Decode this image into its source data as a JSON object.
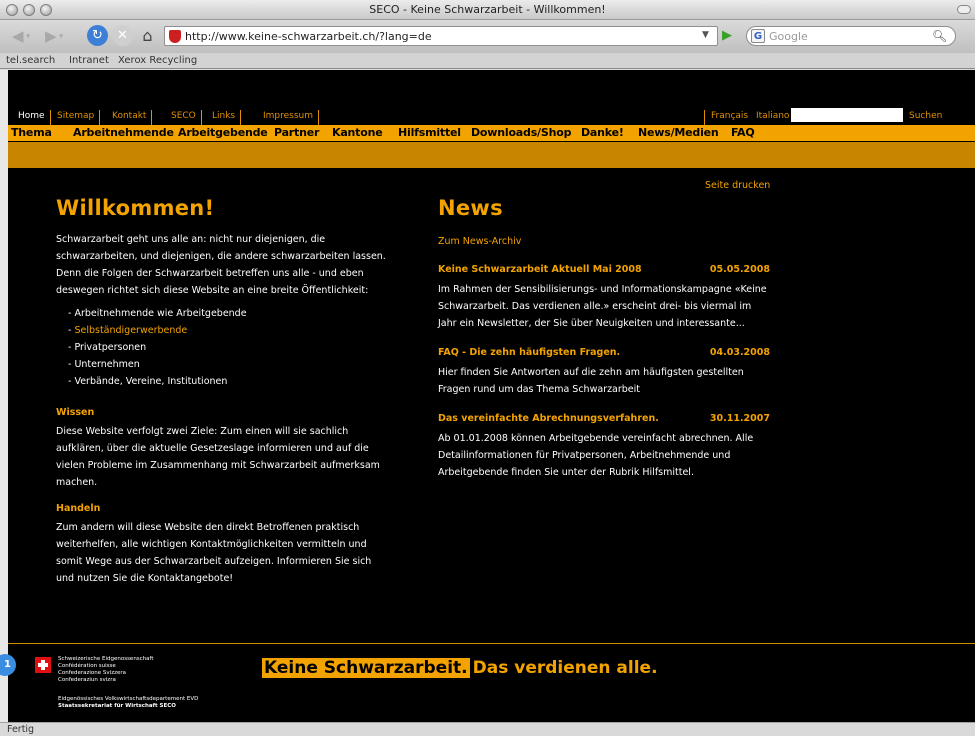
{
  "window": {
    "title": "SECO - Keine Schwarzarbeit - Willkommen!"
  },
  "toolbar": {
    "back_label": "◀",
    "forward_label": "▶",
    "url": "http://www.keine-schwarzarbeit.ch/?lang=de",
    "search_placeholder": "Google",
    "search_engine_letter": "G"
  },
  "bookmarks": [
    "tel.search",
    "Intranet",
    "Xerox Recycling"
  ],
  "site": {
    "topnav": [
      "Home",
      "Sitemap",
      "Kontakt",
      "SECO",
      "Links",
      "Impressum"
    ],
    "languages": [
      "Français",
      "Italiano"
    ],
    "search_button": "Suchen",
    "mainnav": [
      "Thema",
      "Arbeitnehmende",
      "Arbeitgebende",
      "Partner",
      "Kantone",
      "Hilfsmittel",
      "Downloads/Shop",
      "Danke!",
      "News/Medien",
      "FAQ"
    ],
    "print_link": "Seite drucken"
  },
  "welcome": {
    "title": "Willkommen!",
    "intro_lines": [
      "Schwarzarbeit geht uns alle an: nicht nur diejenigen, die",
      "schwarzarbeiten, und diejenigen, die andere schwarzarbeiten lassen.",
      "Denn die Folgen der Schwarzarbeit betreffen uns alle - und eben",
      "deswegen richtet sich diese Website an eine breite Öffentlichkeit:"
    ],
    "audiences": [
      "Arbeitnehmende wie Arbeitgebende",
      "Selbständigerwerbende",
      "Privatpersonen",
      "Unternehmen",
      "Verbände, Vereine, Institutionen"
    ],
    "wissen_title": "Wissen",
    "wissen_lines": [
      "Diese Website verfolgt zwei Ziele: Zum einen will sie sachlich",
      "aufklären, über die aktuelle Gesetzeslage informieren und auf die",
      "vielen Probleme im Zusammenhang mit Schwarzarbeit aufmerksam",
      "machen."
    ],
    "handeln_title": "Handeln",
    "handeln_lines": [
      "Zum andern will diese Website den direkt Betroffenen praktisch",
      "weiterhelfen, alle wichtigen Kontaktmöglichkeiten vermitteln und",
      "somit Wege aus der Schwarzarbeit aufzeigen. Informieren Sie sich",
      "und nutzen Sie die Kontaktangebote!"
    ]
  },
  "news": {
    "title": "News",
    "archive_link": "Zum News-Archiv",
    "items": [
      {
        "title": "Keine Schwarzarbeit Aktuell Mai 2008",
        "date": "05.05.2008",
        "lines": [
          "Im Rahmen der Sensibilisierungs- und Informationskampagne «Keine",
          "Schwarzarbeit. Das verdienen alle.» erscheint drei- bis viermal im",
          "Jahr ein Newsletter, der Sie über Neuigkeiten und interessante..."
        ]
      },
      {
        "title": "FAQ - Die zehn häufigsten Fragen.",
        "date": "04.03.2008",
        "lines": [
          "Hier finden Sie Antworten auf die zehn am häufigsten gestellten",
          "Fragen rund um das Thema Schwarzarbeit"
        ]
      },
      {
        "title": "Das vereinfachte Abrechnungsverfahren.",
        "date": "30.11.2007",
        "lines": [
          "Ab 01.01.2008 können Arbeitgebende vereinfacht abrechnen. Alle",
          "Detailinformationen für Privatpersonen, Arbeitnehmende und",
          "Arbeitgebende finden Sie unter der Rubrik Hilfsmittel."
        ]
      }
    ]
  },
  "footer": {
    "confederation": [
      "Schweizerische Eidgenossenschaft",
      "Confédération suisse",
      "Confederazione Svizzera",
      "Confederaziun svizra"
    ],
    "department": "Eidgenössisches Volkswirtschaftsdepartement EVD",
    "secretariat": "Staatssekretariat für Wirtschaft SECO",
    "slogan_highlight": "Keine Schwarzarbeit.",
    "slogan_rest": "Das verdienen alle."
  },
  "badge": "1",
  "status": "Fertig",
  "colors": {
    "accent": "#f3a300",
    "background": "#000000",
    "flag": "#e01010"
  }
}
